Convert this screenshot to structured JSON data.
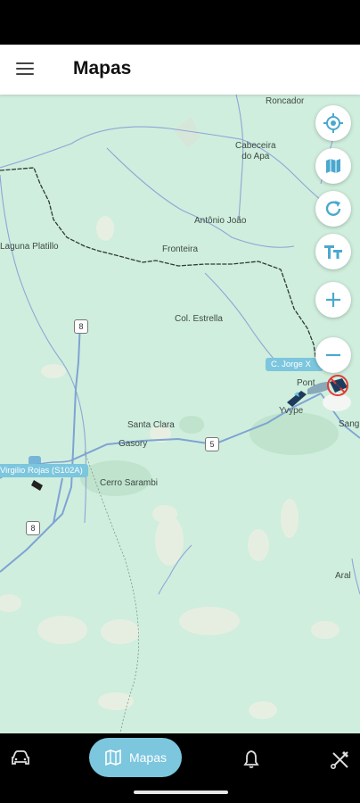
{
  "header": {
    "title": "Mapas"
  },
  "map": {
    "places": {
      "roncador": "Roncador",
      "cabecera": "Cabeceira\ndo Apa",
      "antonio_joao": "Antônio João",
      "laguna_platillo": "Laguna Platillo",
      "fronteira": "Fronteira",
      "col_estrella": "Col. Estrella",
      "santa_clara": "Santa Clara",
      "gasory": "Gasory",
      "cerro_sarambi": "Cerro Sarambi",
      "ponta": "Pont",
      "yvype": "Yvype",
      "sang": "Sang",
      "aral": "Aral"
    },
    "routes": {
      "r8_north": "8",
      "r8_south": "8",
      "r5": "5"
    },
    "stations": {
      "virgilio": "Virgilio Rojas (S102A)",
      "jorge": "C. Jorge X"
    }
  },
  "controls": [
    "locate-icon",
    "map-layers-icon",
    "refresh-icon",
    "text-size-icon",
    "zoom-in-icon",
    "zoom-out-icon"
  ],
  "nav": {
    "items": [
      {
        "name": "vehicles",
        "icon": "car-icon"
      },
      {
        "name": "maps",
        "icon": "map-icon",
        "label": "Mapas",
        "active": true
      },
      {
        "name": "alerts",
        "icon": "bell-icon"
      },
      {
        "name": "tools",
        "icon": "tools-icon"
      }
    ],
    "maps_label": "Mapas"
  },
  "colors": {
    "accent": "#7cc6de",
    "map_bg": "#cfeedd",
    "water": "#8fa5d6"
  }
}
